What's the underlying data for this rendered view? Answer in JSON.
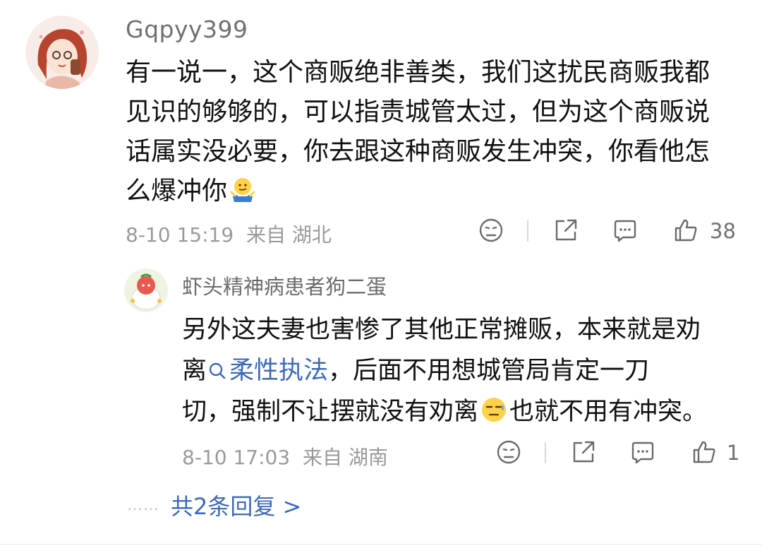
{
  "comment": {
    "username": "Gqpyy399",
    "content_lines": [
      "有一说一，这个商贩绝非善类，我们这扰民商贩我都",
      "见识的够够的，可以指责城管太过，但为这个商贩说",
      "话属实没必要，你去跟这种商贩发生冲突，你看他怎",
      "么爆冲你"
    ],
    "emoji_end": "shrug-emoji",
    "date": "8-10 15:19",
    "location": "来自 湖北",
    "like_count": "38"
  },
  "reply": {
    "username": "虾头精神病患者狗二蛋",
    "content_line1": "另外这夫妻也害惨了其他正常摊贩，本来就是劝",
    "content_line2_prefix": "离",
    "link_text": "柔性执法",
    "content_line2_suffix": "，后面不用想城管局肯定一刀",
    "content_line3_prefix": "切，强制不让摆就没有劝离",
    "content_line3_suffix": "也就不用有冲突。",
    "emoji_mid": "sweat-emoji",
    "date": "8-10 17:03",
    "location": "来自 湖南",
    "like_count": "1"
  },
  "more_replies": {
    "dots": "……",
    "label": "共2条回复 >"
  },
  "colors": {
    "link": "#3d6ab7",
    "meta": "#9a9a9a",
    "text": "#111111"
  }
}
